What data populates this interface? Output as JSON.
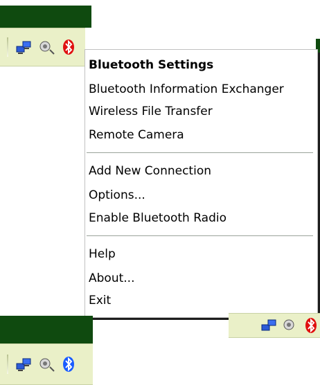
{
  "menu": {
    "items": [
      {
        "label": "Bluetooth Settings",
        "bold": true
      },
      {
        "label": "Bluetooth Information Exchanger"
      },
      {
        "label": "Wireless File Transfer"
      },
      {
        "label": "Remote Camera"
      },
      {
        "label": "Add New Connection"
      },
      {
        "label": "Options..."
      },
      {
        "label": "Enable Bluetooth Radio"
      },
      {
        "label": "Help"
      },
      {
        "label": "About..."
      },
      {
        "label": "Exit"
      }
    ]
  },
  "tray_icons": [
    "network-icon",
    "volume-icon",
    "bluetooth-icon"
  ],
  "colors": {
    "taskbar_green": "#0f4a0f",
    "tray_background": "#eaf0c8",
    "bluetooth_blue": "#1a5cff",
    "bluetooth_red": "#e01010"
  }
}
